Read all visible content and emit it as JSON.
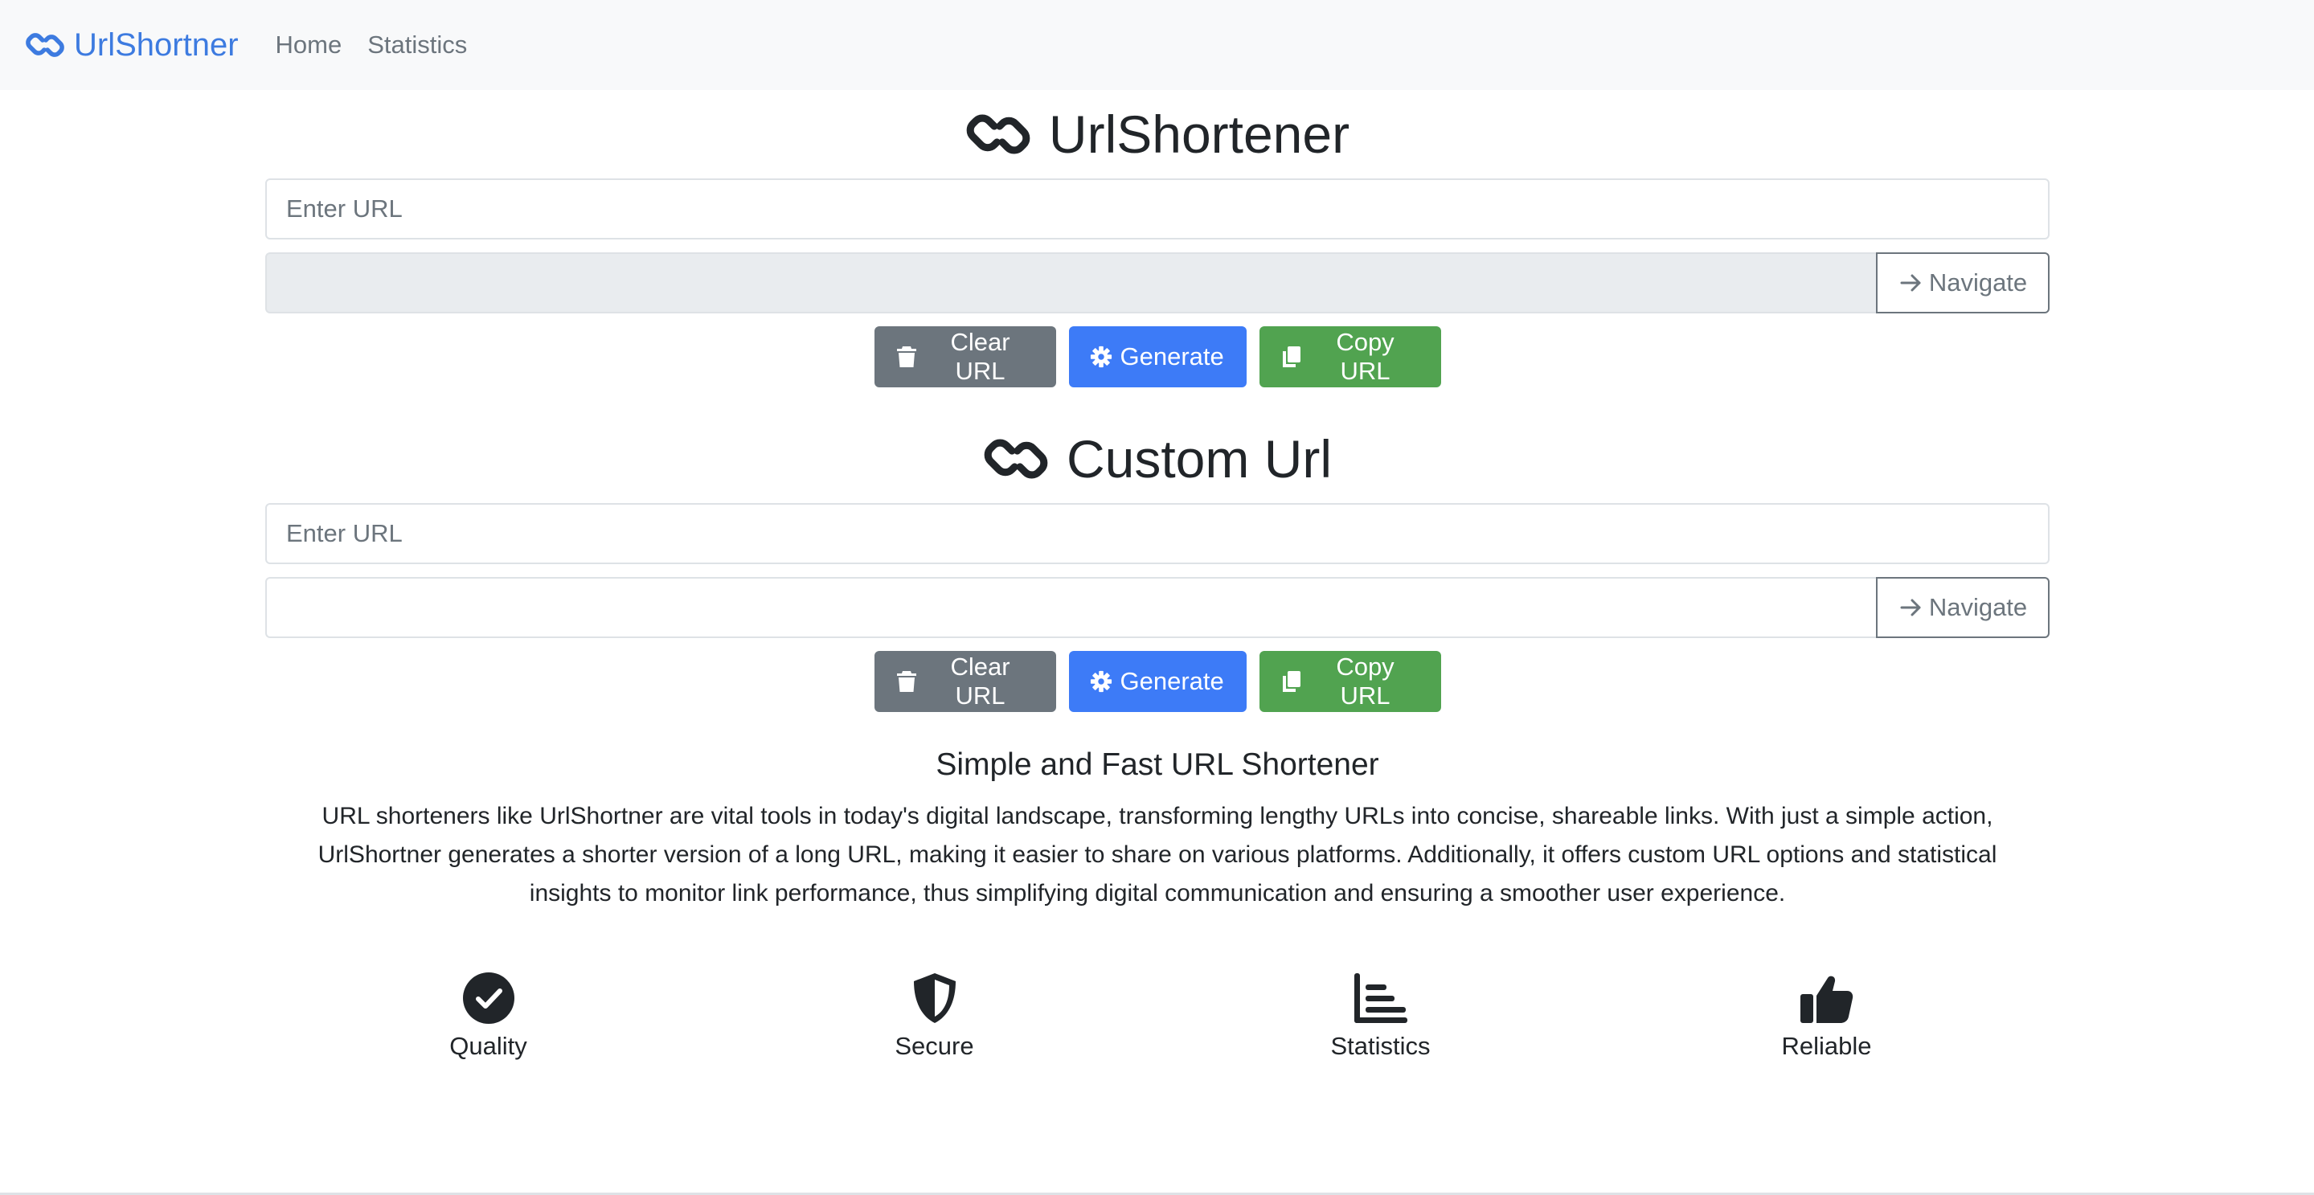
{
  "nav": {
    "brand": "UrlShortner",
    "links": [
      "Home",
      "Statistics"
    ]
  },
  "shortener": {
    "title": "UrlShortener",
    "url_placeholder": "Enter URL",
    "url_value": "",
    "result_value": "",
    "navigate_label": "Navigate",
    "clear_label": "Clear URL",
    "generate_label": "Generate",
    "copy_label": "Copy URL"
  },
  "custom": {
    "title": "Custom Url",
    "url_placeholder": "Enter URL",
    "url_value": "",
    "custom_value": "",
    "navigate_label": "Navigate",
    "clear_label": "Clear URL",
    "generate_label": "Generate",
    "copy_label": "Copy URL"
  },
  "about": {
    "title": "Simple and Fast URL Shortener",
    "lines": [
      "URL shorteners like UrlShortner are vital tools in today's digital landscape, transforming lengthy URLs into concise, shareable links. With just a simple action,",
      "UrlShortner generates a shorter version of a long URL, making it easier to share on various platforms. Additionally, it offers custom URL options and statistical",
      "insights to monitor link performance, thus simplifying digital communication and ensuring a smoother user experience."
    ]
  },
  "features": [
    {
      "label": "Quality",
      "icon": "check-circle-icon"
    },
    {
      "label": "Secure",
      "icon": "shield-icon"
    },
    {
      "label": "Statistics",
      "icon": "bar-chart-icon"
    },
    {
      "label": "Reliable",
      "icon": "thumbs-up-icon"
    }
  ],
  "colors": {
    "brand": "#3d7be0",
    "primary": "#3d7bf7",
    "secondary": "#6c757d",
    "success": "#51a350"
  }
}
